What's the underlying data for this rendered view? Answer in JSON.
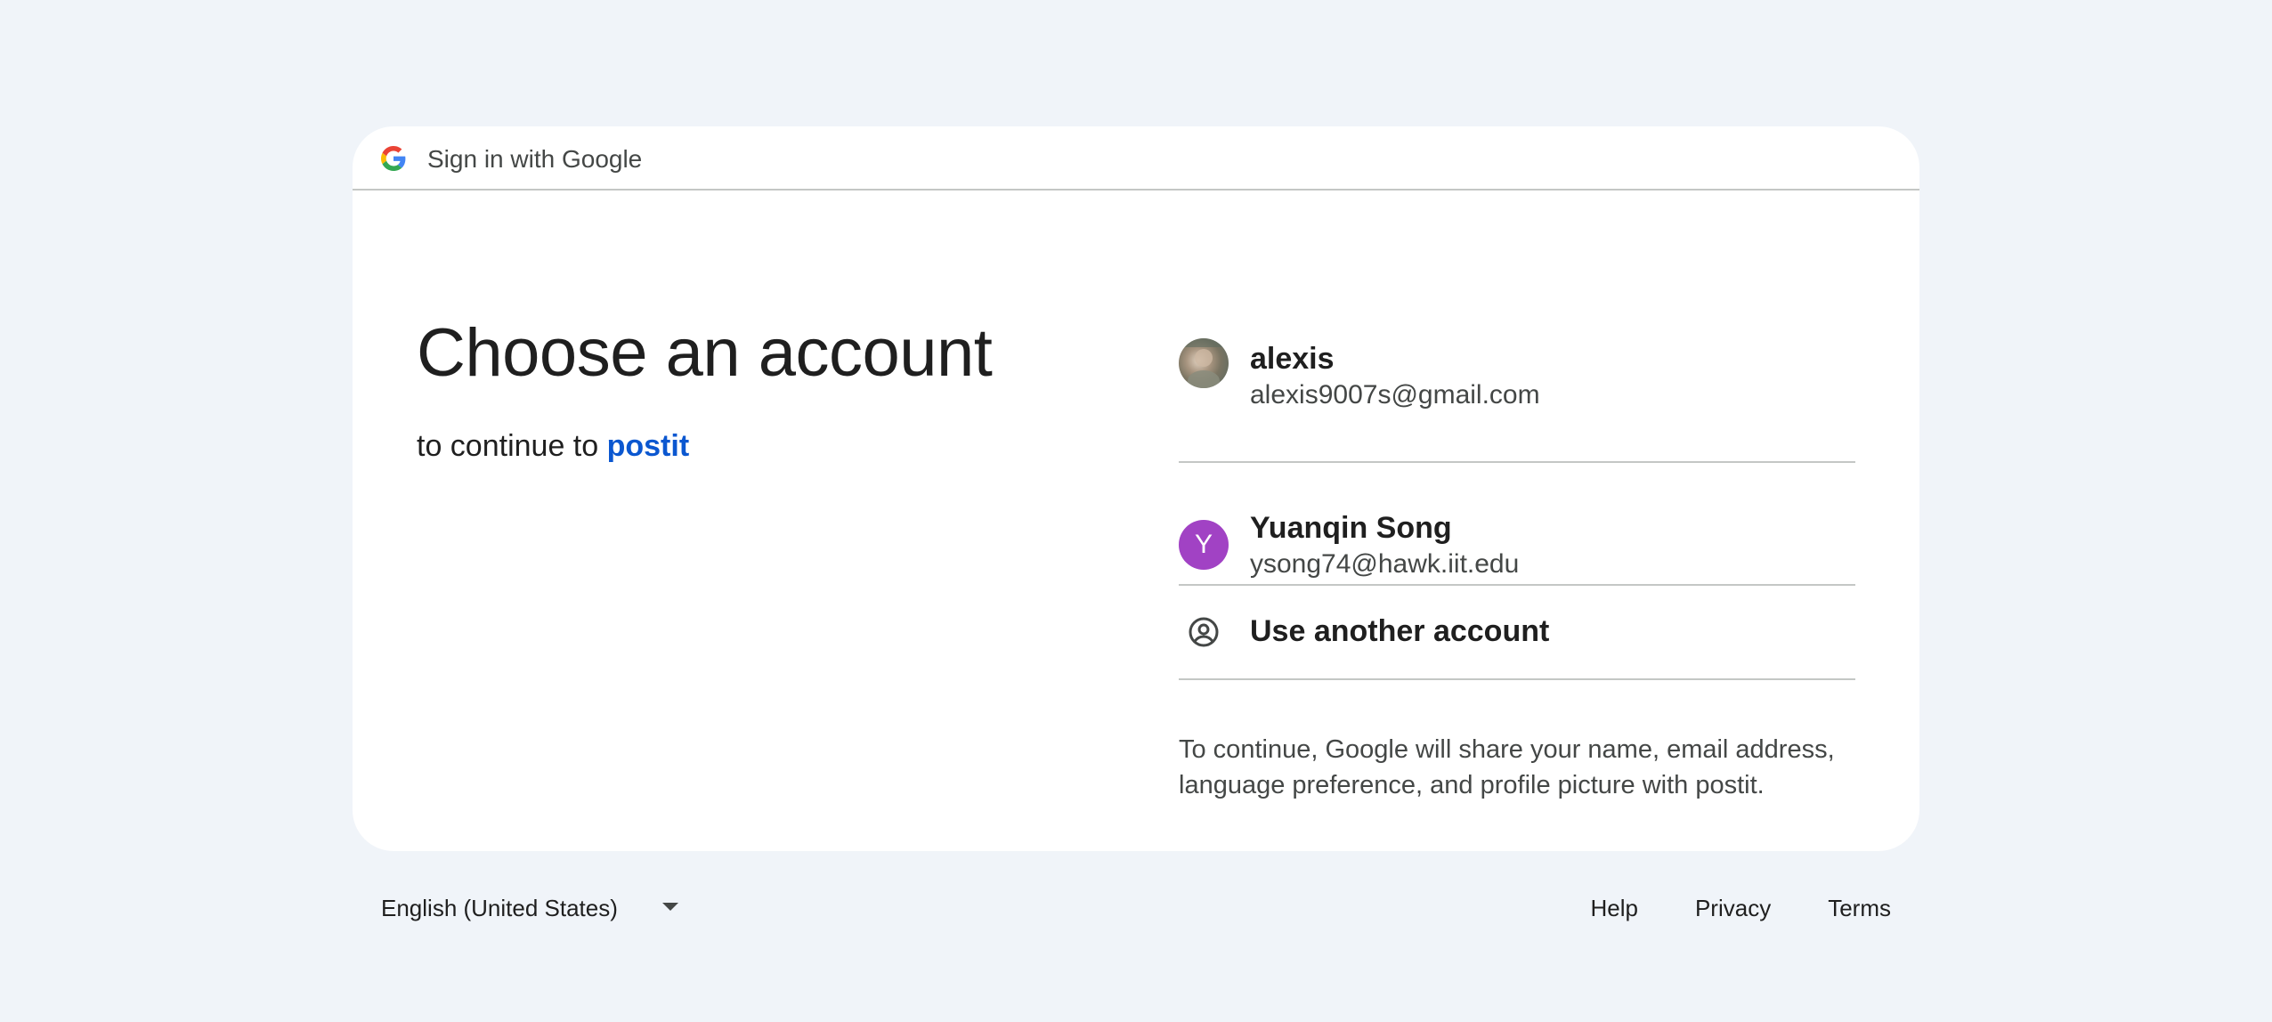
{
  "header": {
    "logo_icon": "google-g-icon",
    "title": "Sign in with Google"
  },
  "main": {
    "heading": "Choose an account",
    "continue_prefix": "to continue to",
    "app_name": "postit"
  },
  "accounts": [
    {
      "name": "alexis",
      "email": "alexis9007s@gmail.com",
      "avatar": "profile-photo"
    },
    {
      "name": "Yuanqin Song",
      "email": "ysong74@hawk.iit.edu",
      "avatar_initial": "Y",
      "avatar_color": "#a142c4"
    }
  ],
  "other_account": {
    "icon": "account-circle-icon",
    "label": "Use another account"
  },
  "disclaimer": "To continue, Google will share your name, email address, language preference, and profile picture with postit.",
  "footer": {
    "language": "English (United States)",
    "language_icon": "caret-down-icon",
    "links": [
      "Help",
      "Privacy",
      "Terms"
    ]
  },
  "colors": {
    "background": "#f0f4f9",
    "card": "#ffffff",
    "link": "#0b57d0",
    "divider": "#c4c7c5"
  }
}
